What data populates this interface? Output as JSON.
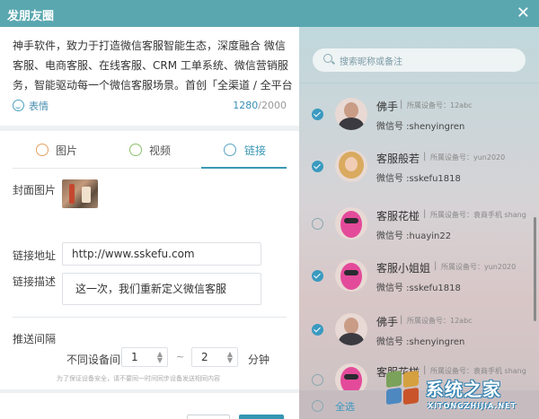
{
  "window": {
    "title": "发朋友圈",
    "close_icon": "close-icon"
  },
  "post": {
    "text": "神手软件，致力于打造微信客服智能生态，深度融合 微信客服、电商客服、在线客服、CRM 工单系统、微信营销服务，智能驱动每一个微信客服场景。首创「全渠道 / 全平台 / 全行业 …",
    "emoji_label": "表情",
    "count_current": "1280",
    "count_max": "/2000"
  },
  "tabs": [
    {
      "label": "图片",
      "icon": "image-icon",
      "active": false
    },
    {
      "label": "视频",
      "icon": "video-icon",
      "active": false
    },
    {
      "label": "链接",
      "icon": "link-icon",
      "active": true
    }
  ],
  "form": {
    "cover_label": "封面图片",
    "url_label": "链接地址",
    "url_value": "http://www.sskefu.com",
    "desc_label": "链接描述",
    "desc_value": "这一次，我们重新定义微信客服",
    "interval_title": "推送间隔",
    "interval_label": "不同设备间隔",
    "interval_from": "1",
    "interval_sep": "~",
    "interval_to": "2",
    "interval_unit": "分钟",
    "hint": "为了保证设备安全，请不要同一时间同步设备发送相同内容"
  },
  "actions": {
    "cancel": "取消",
    "send": "发送"
  },
  "search": {
    "placeholder": "搜索昵称或备注"
  },
  "contacts": [
    {
      "name": "佛手",
      "pipe": "|",
      "device": "所属设备号：12abc",
      "wechat": "微信号 :shenyingren",
      "checked": true,
      "avatar": "man"
    },
    {
      "name": "客服般若",
      "pipe": "|",
      "device": "所属设备号：yun2020",
      "wechat": "微信号 :sskefu1818",
      "checked": true,
      "avatar": "girl"
    },
    {
      "name": "客服花椪",
      "pipe": "|",
      "device": "所属设备号：袁商手机 shang",
      "wechat": "微信号 :huayin22",
      "checked": false,
      "avatar": "pink"
    },
    {
      "name": "客服小姐姐",
      "pipe": "|",
      "device": "所属设备号：yun2020",
      "wechat": "微信号 :sskefu1818",
      "checked": true,
      "avatar": "pink"
    },
    {
      "name": "佛手",
      "pipe": "|",
      "device": "所属设备号：12abc",
      "wechat": "微信号 :shenyingren",
      "checked": true,
      "avatar": "man"
    },
    {
      "name": "客服花椪",
      "pipe": "|",
      "device": "所属设备号：袁商手机 shang",
      "wechat": "",
      "checked": false,
      "avatar": "pink"
    }
  ],
  "select_all": "全选",
  "watermark": {
    "name": "系统之家",
    "site": "XITONGZHIJIA.NET"
  },
  "colors": {
    "titlebar": "#5aa7b0",
    "accent": "#3496b2",
    "check": "#3a9ac0"
  }
}
